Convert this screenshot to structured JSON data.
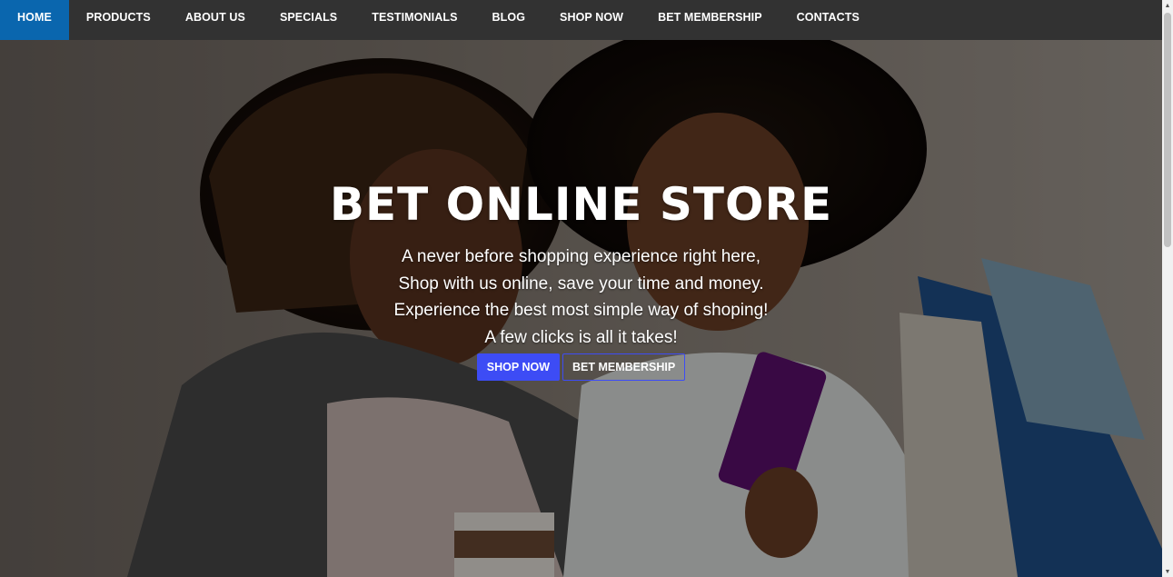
{
  "nav": {
    "items": [
      {
        "label": "HOME",
        "active": true
      },
      {
        "label": "PRODUCTS",
        "active": false
      },
      {
        "label": "ABOUT US",
        "active": false
      },
      {
        "label": "SPECIALS",
        "active": false
      },
      {
        "label": "TESTIMONIALS",
        "active": false
      },
      {
        "label": "BLOG",
        "active": false
      },
      {
        "label": "SHOP NOW",
        "active": false
      },
      {
        "label": "BET MEMBERSHIP",
        "active": false
      },
      {
        "label": "CONTACTS",
        "active": false
      }
    ],
    "active_color": "#0a66ae",
    "bg_color": "#323232"
  },
  "hero": {
    "title": "BET ONLINE STORE",
    "lines": [
      "A never before shopping experience right here,",
      "Shop with us online, save your time and money.",
      "Experience the best most simple way of shoping!",
      "A few clicks is all it takes!"
    ],
    "primary_button": "SHOP NOW",
    "secondary_button": "BET MEMBERSHIP",
    "button_color": "#3d4cf5",
    "image": "photo of two women smiling at a smartphone with shopping bags"
  },
  "scrollbar": {
    "up_icon": "scroll-up-arrow-icon",
    "down_icon": "scroll-down-arrow-icon"
  }
}
